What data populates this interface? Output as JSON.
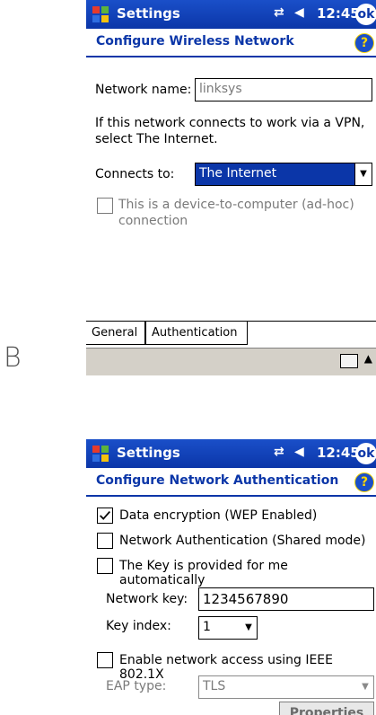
{
  "side_label": "B",
  "panel_a": {
    "app_title": "Settings",
    "time": "12:45",
    "ok_label": "ok",
    "help_label": "?",
    "heading": "Configure Wireless Network",
    "network_name_label": "Network name:",
    "network_name_value": "linksys",
    "info_text": "If this network connects to work via a VPN, select The Internet.",
    "connects_to_label": "Connects to:",
    "connects_to_value": "The Internet",
    "adhoc_label": "This is a device-to-computer (ad-hoc) connection",
    "tabs": [
      "General",
      "Authentication"
    ]
  },
  "panel_b": {
    "app_title": "Settings",
    "time": "12:45",
    "ok_label": "ok",
    "help_label": "?",
    "heading": "Configure Network Authentication",
    "data_encryption_label": "Data encryption (WEP Enabled)",
    "network_auth_label": "Network Authentication (Shared mode)",
    "key_auto_label": "The Key is provided for me automatically",
    "network_key_label": "Network key:",
    "network_key_value": "1234567890",
    "key_index_label": "Key index:",
    "key_index_value": "1",
    "ieee_label": "Enable network access using IEEE 802.1X",
    "eap_type_label": "EAP type:",
    "eap_type_value": "TLS",
    "properties_label": "Properties"
  }
}
